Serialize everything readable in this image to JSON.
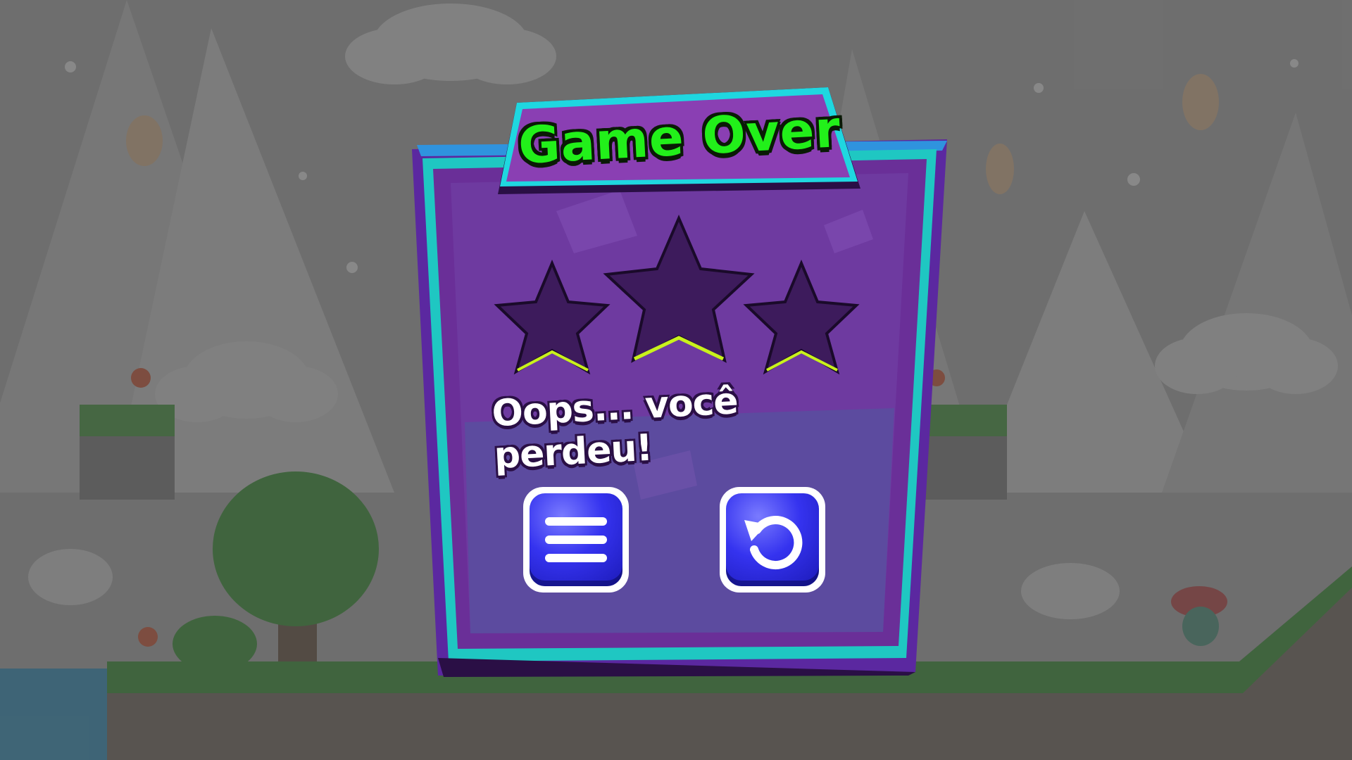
{
  "dialog": {
    "title": "Game Over",
    "message": "Oops... você perdeu!",
    "stars_earned": 0,
    "stars_total": 3
  },
  "buttons": {
    "menu_icon": "menu-icon",
    "retry_icon": "retry-icon"
  },
  "colors": {
    "title_green": "#22f01a",
    "panel_purple": "#6a2f98",
    "frame_teal": "#1fc7c2",
    "button_blue": "#3533ef",
    "star_empty": "#3d1b5c",
    "star_edge": "#c9f21c"
  }
}
